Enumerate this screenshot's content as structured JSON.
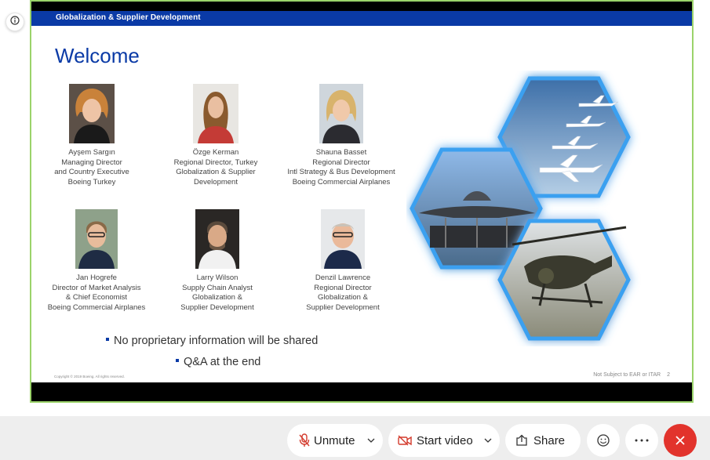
{
  "slide": {
    "header": "Globalization & Supplier Development",
    "title": "Welcome",
    "people": [
      {
        "name": "Ayşem Sargın",
        "lines": [
          "Managing Director",
          "and Country Executive",
          "Boeing Turkey"
        ]
      },
      {
        "name": "Özge Kerman",
        "lines": [
          "Regional Director, Turkey",
          "Globalization & Supplier",
          "Development"
        ]
      },
      {
        "name": "Shauna Basset",
        "lines": [
          "Regional Director",
          "Intl Strategy & Bus Development",
          "Boeing Commercial Airplanes"
        ]
      },
      {
        "name": "Jan Hogrefe",
        "lines": [
          "Director of Market Analysis",
          "& Chief Economist",
          "Boeing Commercial Airplanes"
        ]
      },
      {
        "name": "Larry Wilson",
        "lines": [
          "Supply Chain Analyst",
          "Globalization &",
          "Supplier Development"
        ]
      },
      {
        "name": "Denzil Lawrence",
        "lines": [
          "Regional Director",
          "Globalization &",
          "Supplier Development"
        ]
      }
    ],
    "bullets": [
      "No proprietary information will be shared",
      "Q&A at the end"
    ],
    "footer_left": "Copyright © 2019 Boeing. All rights reserved.",
    "footer_right": "Not Subject to EAR or ITAR",
    "page_number": "2"
  },
  "toolbar": {
    "unmute_label": "Unmute",
    "start_video_label": "Start video",
    "share_label": "Share",
    "icons": [
      "info-icon",
      "microphone-muted-icon",
      "chevron-down-icon",
      "video-camera-off-icon",
      "share-icon",
      "emoji-icon",
      "more-icon",
      "end-call-icon"
    ]
  },
  "colors": {
    "slide_blue": "#0a3aa6",
    "screen_border": "#9bd36a",
    "end_button": "#e2332c",
    "video_off_icon": "#d33a2c",
    "hex_glow": "#4fa8f0"
  }
}
